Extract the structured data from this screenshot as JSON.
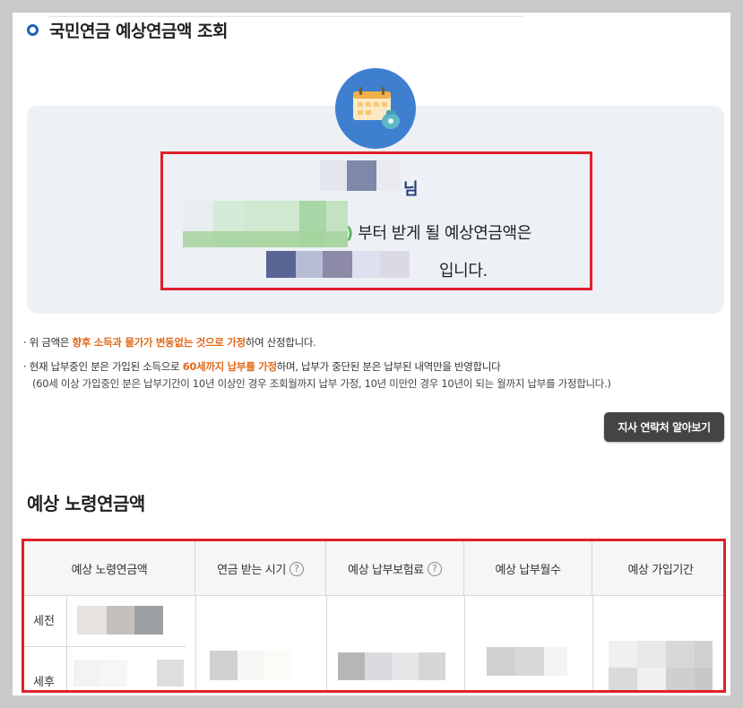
{
  "header": {
    "title": "국민연금 예상연금액 조회"
  },
  "summary": {
    "name_suffix": "님",
    "age_paren": ")",
    "line2_text": "부터 받게 될 예상연금액은",
    "line3_text": "입니다."
  },
  "notes": {
    "note1_bullet": "· 위 금액은 ",
    "note1_highlight": "향후 소득과 물가가 변동없는 것으로 가정",
    "note1_suffix": "하여 산정합니다.",
    "note2_bullet": "· 현재 납부중인 분은 가입된 소득으로 ",
    "note2_highlight": "60세까지 납부를 가정",
    "note2_suffix": "하며, 납부가 중단된 분은 납부된 내역만을 반영합니다",
    "note2_sub": "(60세 이상 가입중인 분은 납부기간이 10년 이상인 경우 조회월까지 납부 가정, 10년 미만인 경우 10년이 되는 월까지 납부를 가정합니다.)"
  },
  "branch_button_label": "지사 연락처 알아보기",
  "section": {
    "title": "예상 노령연금액"
  },
  "table": {
    "columns": [
      "예상 노령연금액",
      "연금 받는 시기",
      "예상 납부보험료",
      "예상 납부월수",
      "예상 가입기간"
    ],
    "help_icon_glyph": "?",
    "row_labels": [
      "세전",
      "세후"
    ]
  },
  "colors": {
    "accent_blue": "#3e7fd0",
    "highlight_orange": "#e06a1a",
    "annotation_red": "#e0202a"
  },
  "icons": {
    "title_marker": "circle-marker-icon",
    "hero": "calendar-money-icon",
    "help": "question-circle-icon"
  }
}
